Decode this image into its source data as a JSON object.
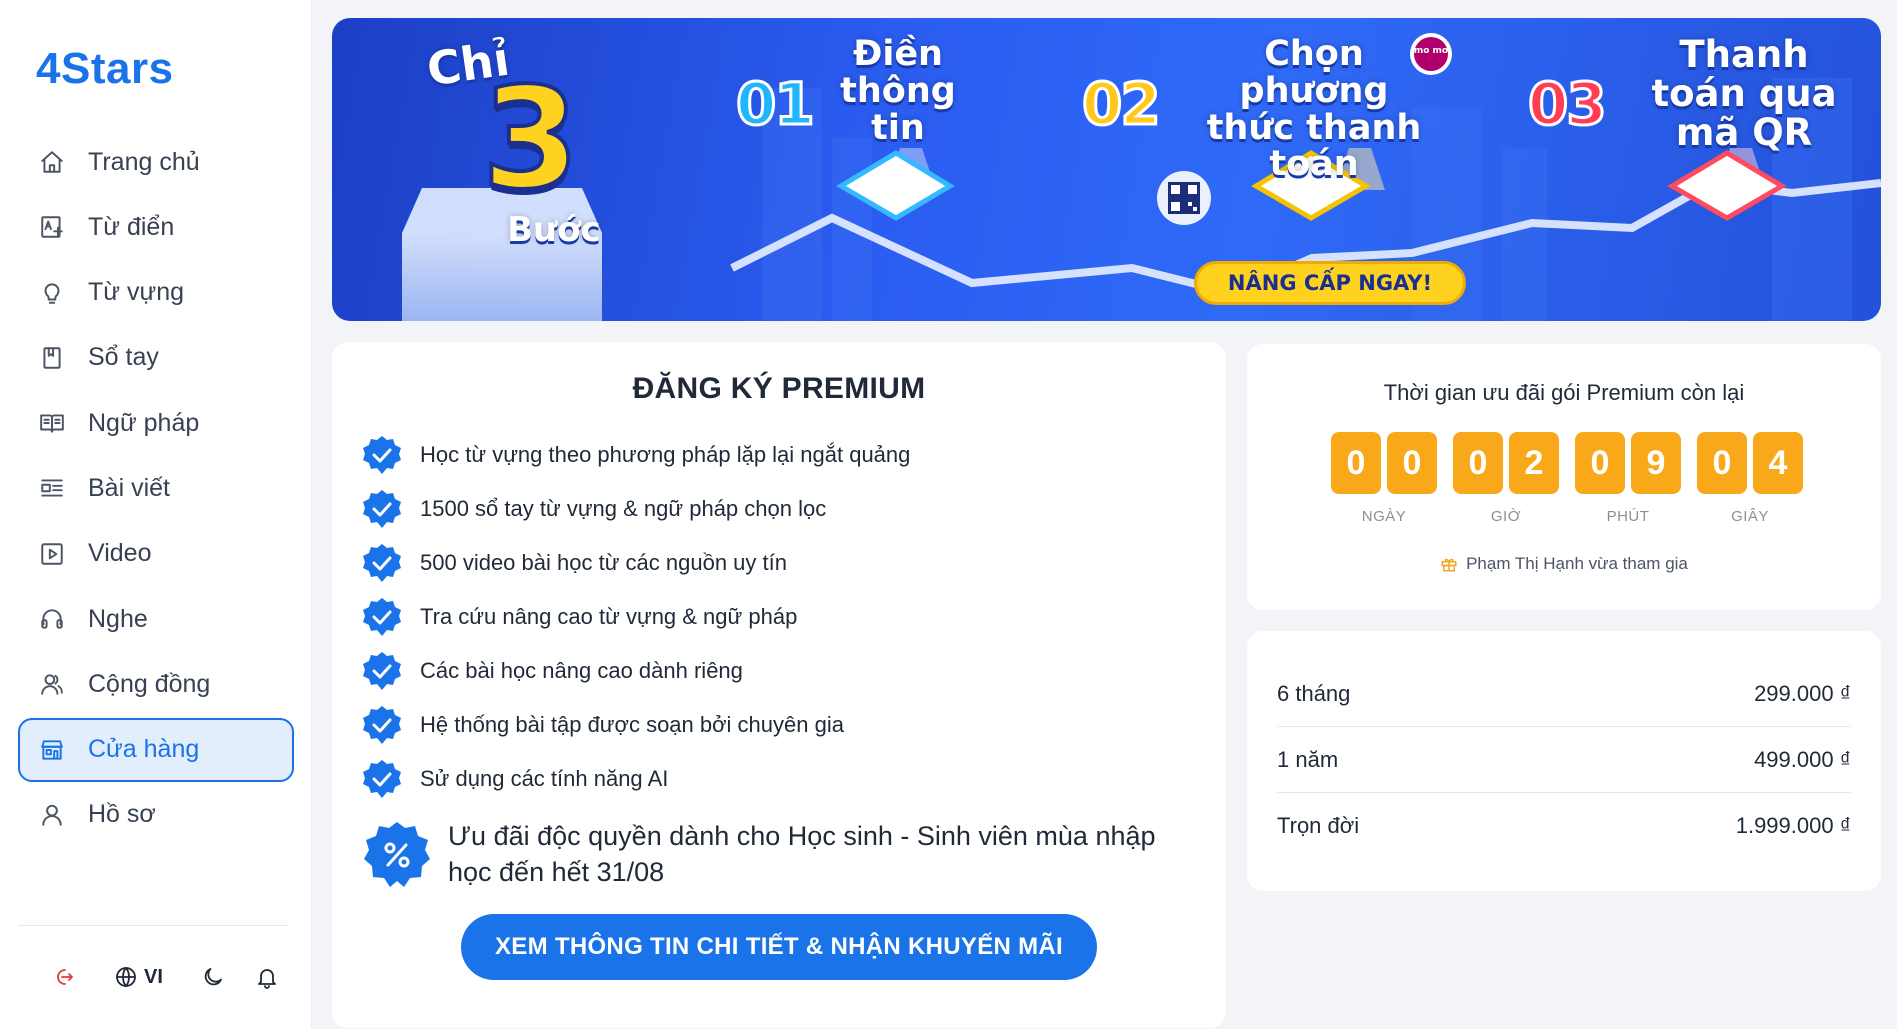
{
  "app": {
    "logo": "4Stars"
  },
  "sidebar": {
    "items": [
      {
        "label": "Trang chủ",
        "icon": "home-icon"
      },
      {
        "label": "Từ điển",
        "icon": "dictionary-icon"
      },
      {
        "label": "Từ vựng",
        "icon": "lightbulb-icon"
      },
      {
        "label": "Sổ tay",
        "icon": "notebook-icon"
      },
      {
        "label": "Ngữ pháp",
        "icon": "book-open-icon"
      },
      {
        "label": "Bài viết",
        "icon": "article-icon"
      },
      {
        "label": "Video",
        "icon": "video-icon"
      },
      {
        "label": "Nghe",
        "icon": "headphones-icon"
      },
      {
        "label": "Cộng đồng",
        "icon": "community-icon"
      },
      {
        "label": "Cửa hàng",
        "icon": "store-icon",
        "active": true
      },
      {
        "label": "Hồ sơ",
        "icon": "user-icon"
      }
    ],
    "footer": {
      "language": "VI"
    }
  },
  "banner": {
    "intro_top": "Chỉ",
    "intro_number": "3",
    "intro_bottom": "Bước",
    "steps": [
      {
        "num": "01",
        "text": "Điền thông tin"
      },
      {
        "num": "02",
        "text": "Chọn phương thức thanh toán"
      },
      {
        "num": "03",
        "text": "Thanh toán qua mã QR"
      }
    ],
    "momo_label": "mo mo",
    "cta": "NÂNG CẤP NGAY!"
  },
  "premium": {
    "title": "ĐĂNG KÝ PREMIUM",
    "benefits": [
      "Học từ vựng theo phương pháp lặp lại ngắt quảng",
      "1500 sổ tay từ vựng & ngữ pháp chọn lọc",
      "500 video bài học từ các nguồn uy tín",
      "Tra cứu nâng cao từ vựng & ngữ pháp",
      "Các bài học nâng cao dành riêng",
      "Hệ thống bài tập được soạn bởi chuyên gia",
      "Sử dụng các tính năng AI"
    ],
    "offer": "Ưu đãi độc quyền dành cho Học sinh - Sinh viên mùa nhập học đến hết 31/08",
    "button": "XEM THÔNG TIN CHI TIẾT & NHẬN KHUYẾN MÃI"
  },
  "countdown": {
    "title": "Thời gian ưu đãi gói Premium còn lại",
    "units": [
      {
        "label": "NGÀY",
        "digits": [
          "0",
          "0"
        ]
      },
      {
        "label": "GIỜ",
        "digits": [
          "0",
          "2"
        ]
      },
      {
        "label": "PHÚT",
        "digits": [
          "0",
          "9"
        ]
      },
      {
        "label": "GIÂY",
        "digits": [
          "0",
          "4"
        ]
      }
    ],
    "joined": "Phạm Thị Hạnh vừa tham gia"
  },
  "pricing": {
    "plans": [
      {
        "name": "6 tháng",
        "price": "299.000 ₫"
      },
      {
        "name": "1 năm",
        "price": "499.000 ₫"
      },
      {
        "name": "Trọn đời",
        "price": "1.999.000 ₫"
      }
    ]
  },
  "colors": {
    "primary": "#1a73e8",
    "active_bg": "#e3eefc",
    "countdown": "#f9a81a",
    "cta": "#ffd21f"
  }
}
